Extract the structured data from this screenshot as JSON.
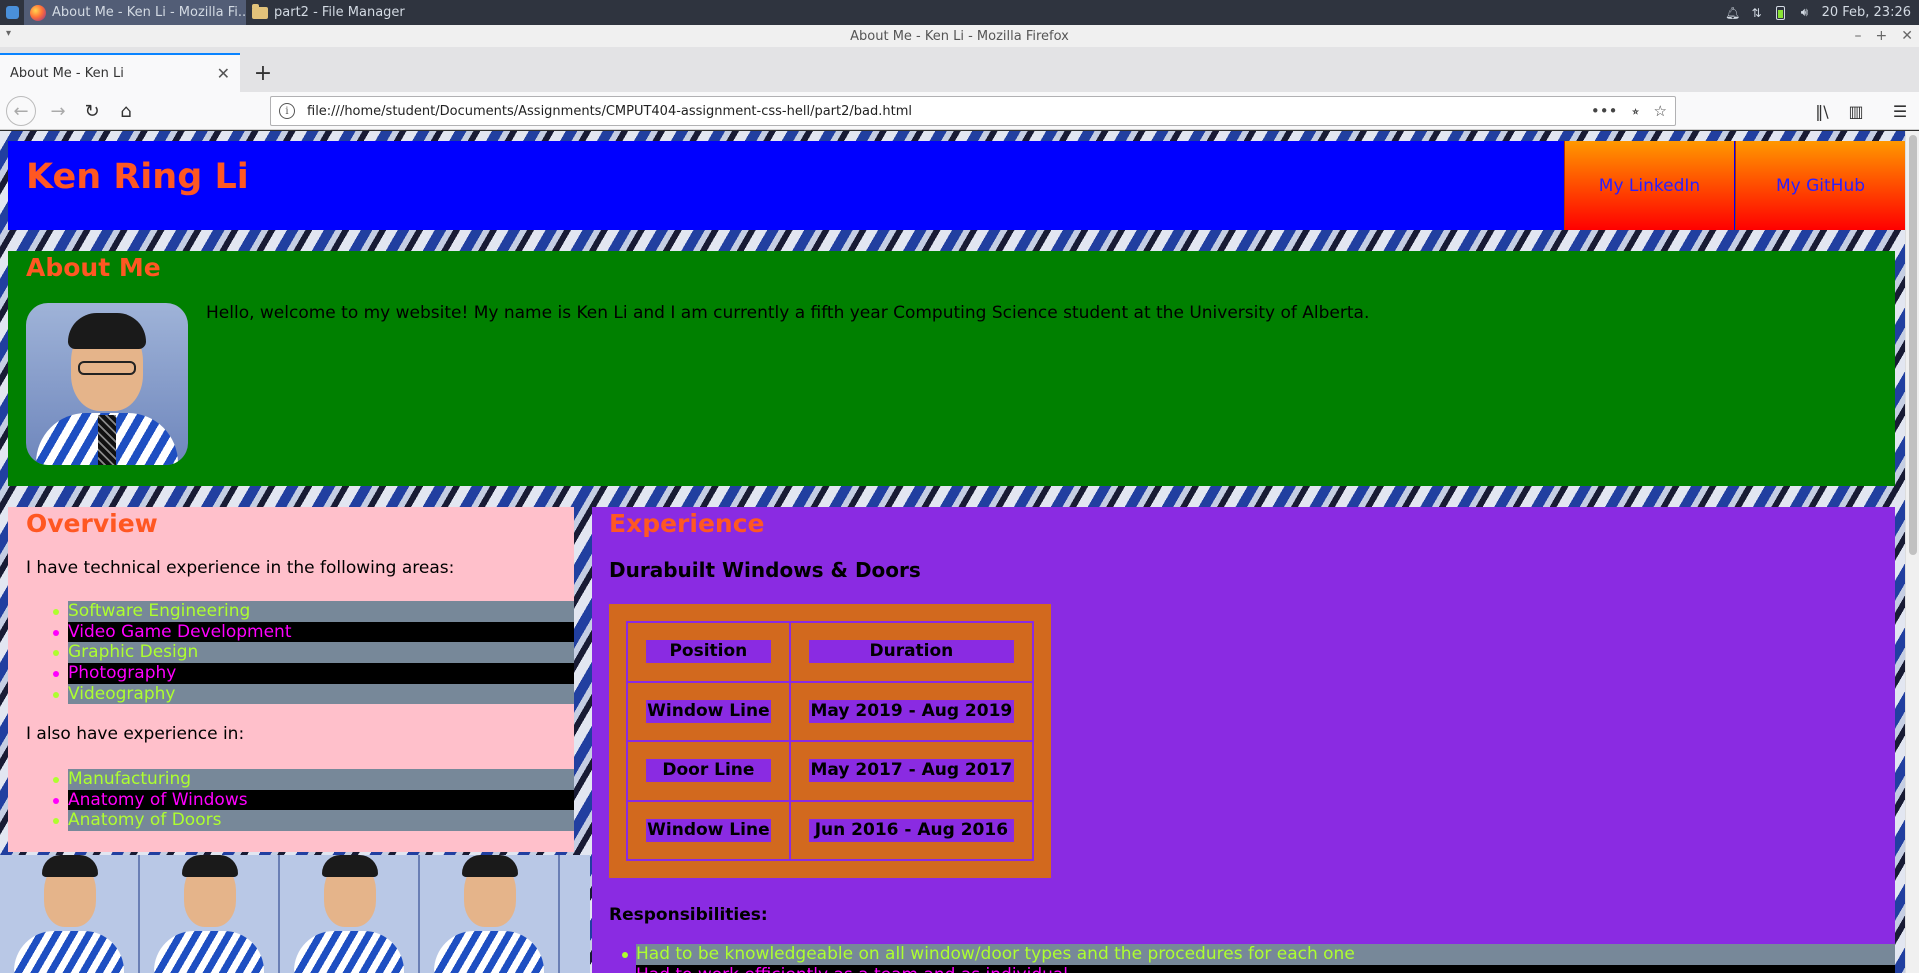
{
  "taskbar": {
    "tasks": [
      {
        "label": "About Me - Ken Li - Mozilla Fi...",
        "active": true
      },
      {
        "label": "part2 - File Manager",
        "active": false
      }
    ],
    "clock": "20 Feb, 23:26"
  },
  "window": {
    "title": "About Me - Ken Li - Mozilla Firefox"
  },
  "browser": {
    "tab_title": "About Me - Ken Li",
    "url": "file:///home/student/Documents/Assignments/CMPUT404-assignment-css-hell/part2/bad.html"
  },
  "page": {
    "header": {
      "title": "Ken Ring Li",
      "links": [
        "My LinkedIn",
        "My GitHub"
      ]
    },
    "about": {
      "heading": "About Me",
      "text": "Hello, welcome to my website! My name is Ken Li and I am currently a fifth year Computing Science student at the University of Alberta."
    },
    "overview": {
      "heading": "Overview",
      "intro": "I have technical experience in the following areas:",
      "areas": [
        "Software Engineering",
        "Video Game Development",
        "Graphic Design",
        "Photography",
        "Videography"
      ],
      "intro2": "I also have experience in:",
      "other_areas": [
        "Manufacturing",
        "Anatomy of Windows",
        "Anatomy of Doors"
      ]
    },
    "experience": {
      "heading": "Experience",
      "company": "Durabuilt Windows & Doors",
      "table": {
        "headers": [
          "Position",
          "Duration"
        ],
        "rows": [
          [
            "Window Line",
            "May 2019 - Aug 2019"
          ],
          [
            "Door Line",
            "May 2017 - Aug 2017"
          ],
          [
            "Window Line",
            "Jun 2016 - Aug 2016"
          ]
        ]
      },
      "responsibilities_title": "Responsibilities:",
      "responsibilities": [
        "Had to be knowledgeable on all window/door types and the procedures for each one",
        "Had to work efficiently as a team and as individual"
      ]
    }
  },
  "colors": {
    "header_bg": "#0000ff",
    "about_bg": "#008000",
    "overview_bg": "#ffc0cb",
    "experience_bg": "#8a2be2",
    "table_bg": "#d2691e",
    "heading_color": "#ff5722"
  }
}
